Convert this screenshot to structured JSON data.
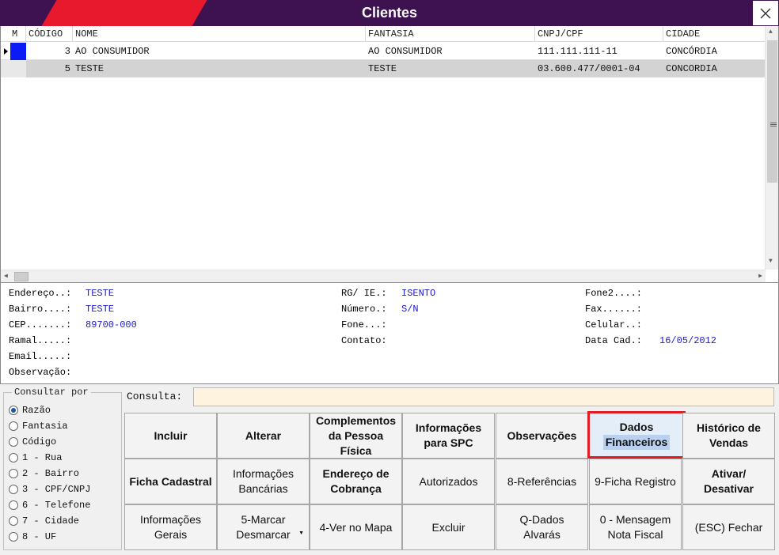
{
  "window": {
    "title": "Clientes"
  },
  "grid": {
    "columns": [
      "M",
      "CÓDIGO",
      "NOME",
      "FANTASIA",
      "CNPJ/CPF",
      "CIDADE"
    ],
    "rows": [
      {
        "codigo": "3",
        "nome": "AO CONSUMIDOR",
        "fantasia": "AO CONSUMIDOR",
        "cnpj": "111.111.111-11",
        "cidade": "CONCÓRDIA"
      },
      {
        "codigo": "5",
        "nome": "TESTE",
        "fantasia": "TESTE",
        "cnpj": "03.600.477/0001-04",
        "cidade": "CONCORDIA"
      }
    ]
  },
  "details": {
    "endereco_label": "Endereço..:",
    "endereco": "TESTE",
    "bairro_label": "Bairro....:",
    "bairro": "TESTE",
    "cep_label": "CEP.......:",
    "cep": "89700-000",
    "ramal_label": "Ramal.....:",
    "email_label": "Email.....:",
    "obs_label": "Observação:",
    "rg_label": "RG/ IE.:",
    "rg": "ISENTO",
    "numero_label": "Número.:",
    "numero": "S/N",
    "fone_label": "Fone...:",
    "contato_label": "Contato:",
    "fone2_label": "Fone2....:",
    "fax_label": "Fax......:",
    "celular_label": "Celular..:",
    "datacad_label": "Data Cad.:",
    "datacad": "16/05/2012"
  },
  "consultar": {
    "legend": "Consultar por",
    "options": [
      "Razão",
      "Fantasia",
      "Código",
      "1 - Rua",
      "2 - Bairro",
      "3 - CPF/CNPJ",
      "6 - Telefone",
      "7 - Cidade",
      "8 - UF"
    ],
    "selected": "Razão"
  },
  "consulta": {
    "label": "Consulta:",
    "value": ""
  },
  "buttons": {
    "incluir": "Incluir",
    "alterar": "Alterar",
    "complementos": [
      "Complementos",
      "da Pessoa",
      "Física"
    ],
    "info_spc": [
      "Informações",
      "para SPC"
    ],
    "observacoes": "Observações",
    "dados_fin": [
      "Dados",
      "Financeiros"
    ],
    "historico": [
      "Histórico de",
      "Vendas"
    ],
    "ficha": "Ficha Cadastral",
    "info_banc": [
      "Informações",
      "Bancárias"
    ],
    "end_cobranca": [
      "Endereço de",
      "Cobrança"
    ],
    "autorizados": "Autorizados",
    "referencias": "8-Referências",
    "ficha_registro": "9-Ficha Registro",
    "ativar": [
      "Ativar/",
      "Desativar"
    ],
    "info_gerais": [
      "Informações",
      "Gerais"
    ],
    "marcar": [
      "5-Marcar",
      "Desmarcar"
    ],
    "ver_mapa": "4-Ver no Mapa",
    "excluir": "Excluir",
    "alvaras": [
      "Q-Dados",
      "Alvarás"
    ],
    "mensagem": [
      "0 - Mensagem",
      "Nota Fiscal"
    ],
    "fechar": "(ESC) Fechar"
  },
  "colors": {
    "title_bg": "#3e1250",
    "title_accent": "#e8192c",
    "value_text": "#1a1ad0",
    "selected_border": "#e31b23"
  }
}
